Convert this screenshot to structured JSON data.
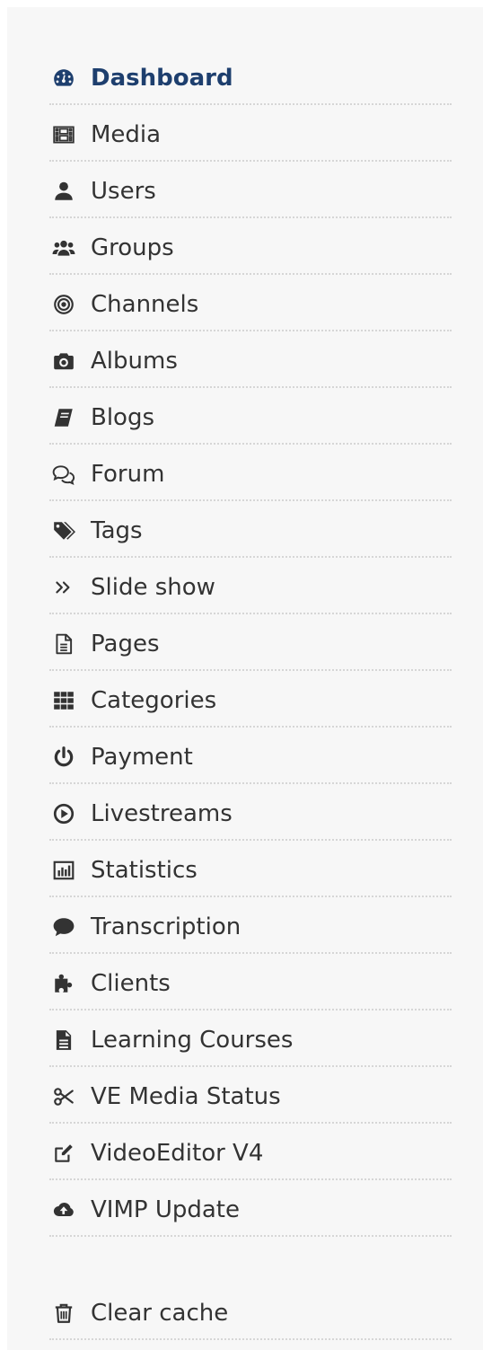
{
  "sidebar": {
    "active_color": "#1e3f6e",
    "text_color": "#333333",
    "items": [
      {
        "label": "Dashboard",
        "icon": "dashboard-icon"
      },
      {
        "label": "Media",
        "icon": "film-icon"
      },
      {
        "label": "Users",
        "icon": "user-icon"
      },
      {
        "label": "Groups",
        "icon": "users-group-icon"
      },
      {
        "label": "Channels",
        "icon": "channels-icon"
      },
      {
        "label": "Albums",
        "icon": "camera-icon"
      },
      {
        "label": "Blogs",
        "icon": "book-icon"
      },
      {
        "label": "Forum",
        "icon": "chat-bubbles-icon"
      },
      {
        "label": "Tags",
        "icon": "tags-icon"
      },
      {
        "label": "Slide show",
        "icon": "double-chevron-right-icon"
      },
      {
        "label": "Pages",
        "icon": "document-icon"
      },
      {
        "label": "Categories",
        "icon": "grid-icon"
      },
      {
        "label": "Payment",
        "icon": "power-icon"
      },
      {
        "label": "Livestreams",
        "icon": "play-circle-icon"
      },
      {
        "label": "Statistics",
        "icon": "bar-chart-icon"
      },
      {
        "label": "Transcription",
        "icon": "comment-icon"
      },
      {
        "label": "Clients",
        "icon": "puzzle-icon"
      },
      {
        "label": "Learning Courses",
        "icon": "file-text-icon"
      },
      {
        "label": "VE Media Status",
        "icon": "scissors-icon"
      },
      {
        "label": "VideoEditor V4",
        "icon": "edit-icon"
      },
      {
        "label": "VIMP Update",
        "icon": "cloud-upload-icon"
      }
    ],
    "footer_items": [
      {
        "label": "Clear cache",
        "icon": "trash-icon"
      }
    ]
  }
}
